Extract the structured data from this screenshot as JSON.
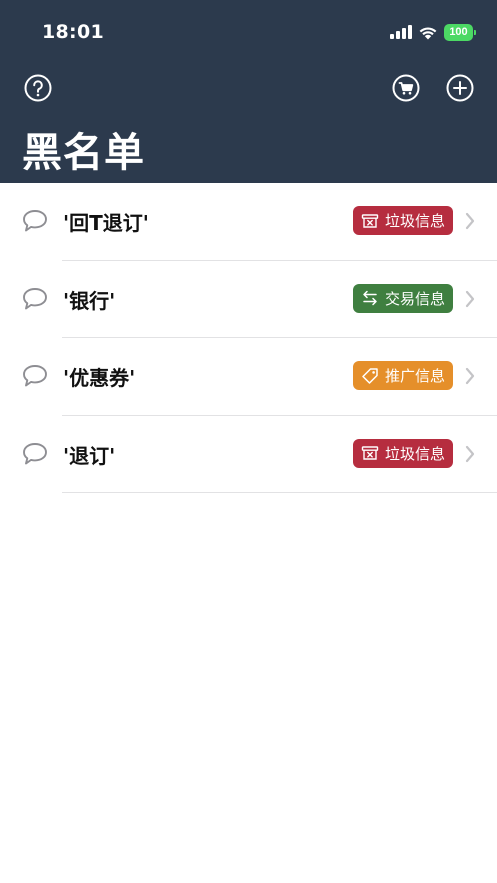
{
  "status_bar": {
    "time": "18:01",
    "battery": "100"
  },
  "nav": {
    "title": "黑名单",
    "icons": [
      "question-icon",
      "cart-icon",
      "plus-icon"
    ]
  },
  "list": {
    "items": [
      {
        "label": "'回T退订'",
        "tag": {
          "text": "垃圾信息",
          "icon": "trash-box-icon",
          "color": "#b62d3f"
        }
      },
      {
        "label": "'银行'",
        "tag": {
          "text": "交易信息",
          "icon": "exchange-icon",
          "color": "#3f7f40"
        }
      },
      {
        "label": "'优惠券'",
        "tag": {
          "text": "推广信息",
          "icon": "tag-icon",
          "color": "#e58f2a"
        }
      },
      {
        "label": "'退订'",
        "tag": {
          "text": "垃圾信息",
          "icon": "trash-box-icon",
          "color": "#b62d3f"
        }
      }
    ]
  },
  "colors": {
    "header_bg": "#2c3a4d",
    "battery": "#4cd964",
    "divider": "#e2e2e4",
    "chevron": "#c4c4c7"
  }
}
